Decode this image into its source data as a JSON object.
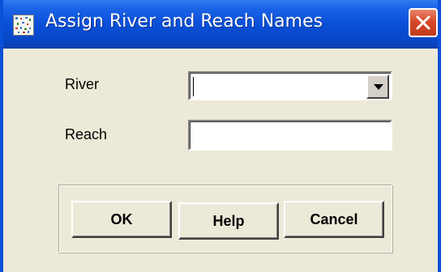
{
  "window": {
    "title": "Assign River and Reach Names",
    "icon": "app-icon",
    "close_icon": "close-icon"
  },
  "form": {
    "river": {
      "label": "River",
      "value": ""
    },
    "reach": {
      "label": "Reach",
      "value": ""
    }
  },
  "buttons": {
    "ok": "OK",
    "help": "Help",
    "cancel": "Cancel"
  },
  "colors": {
    "titlebar": "#0a50d8",
    "dialog_background": "#ece9d8",
    "close_button": "#d6482a"
  }
}
